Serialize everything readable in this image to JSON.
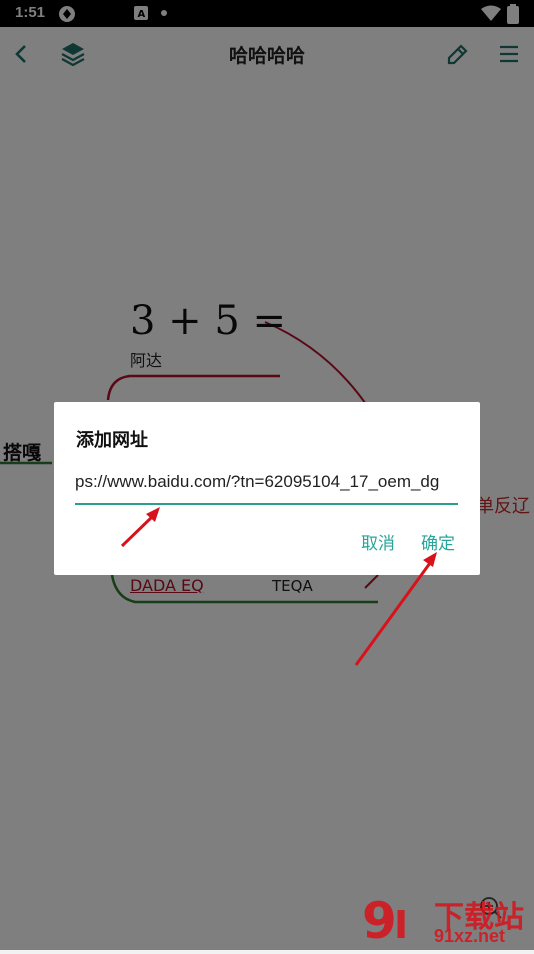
{
  "status_bar": {
    "time": "1:51"
  },
  "app_bar": {
    "title": "哈哈哈哈"
  },
  "mindmap": {
    "formula": "3 + 5 =",
    "formula_note": "阿达",
    "left_node": "搭嘎",
    "link_node": "DADA EQ",
    "right_node": "TEQA",
    "partial_right": "单反辽"
  },
  "dialog": {
    "title": "添加网址",
    "url_value": "ps://www.baidu.com/?tn=62095104_17_oem_dg",
    "cancel_label": "取消",
    "confirm_label": "确定"
  },
  "watermark": {
    "brand": "下载站",
    "site": "91xz.net"
  },
  "colors": {
    "accent": "#26a69a",
    "arrow": "#d8121b",
    "dim": "rgba(0,0,0,0.5)"
  }
}
